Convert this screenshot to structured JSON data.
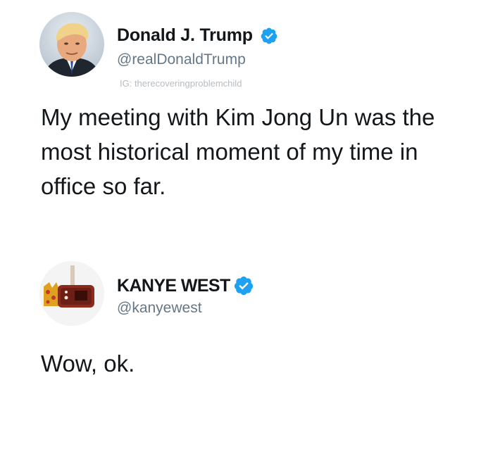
{
  "tweets": [
    {
      "display_name": "Donald J. Trump",
      "handle": "@realDonaldTrump",
      "verified": true,
      "avatar_icon": "avatar-portrait",
      "watermark": "IG: therecoveringproblemchild",
      "text": "My meeting with Kim Jong Un was the most historical moment of my time in office so far."
    },
    {
      "display_name": "KANYE WEST",
      "handle": "@kanyewest",
      "verified": true,
      "avatar_icon": "avatar-sculpture",
      "text": "Wow, ok."
    }
  ],
  "colors": {
    "verified_blue": "#1da1f2",
    "handle_gray": "#657786",
    "text_dark": "#14171a"
  }
}
